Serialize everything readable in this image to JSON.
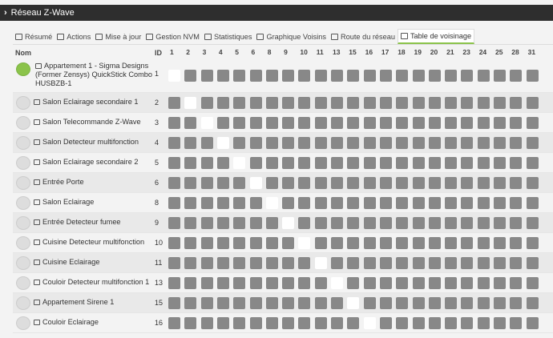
{
  "window": {
    "title": "Réseau Z-Wave"
  },
  "tabs": [
    {
      "label": "Résumé",
      "icon": "summary-icon"
    },
    {
      "label": "Actions",
      "icon": "list-icon"
    },
    {
      "label": "Mise à jour",
      "icon": "car-icon"
    },
    {
      "label": "Gestion NVM",
      "icon": "save-icon"
    },
    {
      "label": "Statistiques",
      "icon": "bar-chart-icon"
    },
    {
      "label": "Graphique Voisins",
      "icon": "image-icon"
    },
    {
      "label": "Route du réseau",
      "icon": "sitemap-icon"
    },
    {
      "label": "Table de voisinage",
      "icon": "table-icon",
      "active": true
    }
  ],
  "table": {
    "col_nom": "Nom",
    "col_id": "ID",
    "columns": [
      "1",
      "2",
      "3",
      "4",
      "5",
      "6",
      "8",
      "9",
      "10",
      "11",
      "13",
      "15",
      "16",
      "17",
      "18",
      "19",
      "20",
      "21",
      "23",
      "24",
      "25",
      "28",
      "31"
    ],
    "rows": [
      {
        "id": "1",
        "name": "Appartement 1 - Sigma Designs (Former Zensys) QuickStick Combo HUSBZB-1",
        "room_icon": "home-icon"
      },
      {
        "id": "2",
        "name": "Salon Eclairage secondaire 1",
        "room_icon": "sofa-icon"
      },
      {
        "id": "3",
        "name": "Salon Telecommande Z-Wave",
        "room_icon": "sofa-icon"
      },
      {
        "id": "4",
        "name": "Salon Detecteur multifonction",
        "room_icon": "sofa-icon"
      },
      {
        "id": "5",
        "name": "Salon Eclairage secondaire 2",
        "room_icon": "sofa-icon"
      },
      {
        "id": "6",
        "name": "Entrée Porte",
        "room_icon": "sign-in-icon"
      },
      {
        "id": "8",
        "name": "Salon Eclairage",
        "room_icon": "sofa-icon"
      },
      {
        "id": "9",
        "name": "Entrée Detecteur fumee",
        "room_icon": "sign-in-icon"
      },
      {
        "id": "10",
        "name": "Cuisine Detecteur multifonction",
        "room_icon": "kitchen-icon"
      },
      {
        "id": "11",
        "name": "Cuisine Eclairage",
        "room_icon": "kitchen-icon"
      },
      {
        "id": "13",
        "name": "Couloir Detecteur multifonction 1",
        "room_icon": "shuffle-icon"
      },
      {
        "id": "15",
        "name": "Appartement Sirene 1",
        "room_icon": "home-icon"
      },
      {
        "id": "16",
        "name": "Couloir Eclairage",
        "room_icon": "shuffle-icon"
      }
    ]
  },
  "colors": {
    "title_bg": "#2e2e2e",
    "cell_linked": "#888888",
    "cell_self": "#ffffff",
    "tab_accent": "#8bc34a"
  }
}
